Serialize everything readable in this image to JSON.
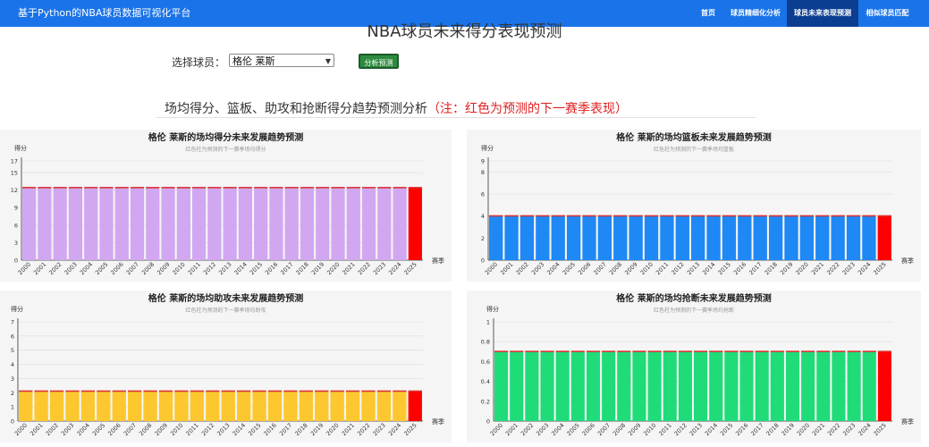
{
  "nav": {
    "brand": "基于Python的NBA球员数据可视化平台",
    "items": [
      {
        "label": "首页",
        "active": false
      },
      {
        "label": "球员精细化分析",
        "active": false
      },
      {
        "label": "球员未来表现预测",
        "active": true
      },
      {
        "label": "相似球员匹配",
        "active": false
      }
    ],
    "color": "#1a73e8",
    "active_color": "#0b3d91"
  },
  "page": {
    "title": "NBA球员未来得分表现预测",
    "select_label": "选择球员：",
    "selected_player": "格伦 莱斯",
    "analyze_button": "分析预测",
    "section_title": "场均得分、篮板、助攻和抢断得分趋势预测分析",
    "section_note": "（注：红色为预测的下一赛季表现）"
  },
  "chart_data": [
    {
      "type": "bar",
      "title": "格伦 莱斯的场均得分未来发展趋势预测",
      "subtitle": "红色柱为预测的下一赛季场均得分",
      "ylabel": "得分",
      "xlabel": "赛季",
      "categories": [
        "2000",
        "2001",
        "2002",
        "2003",
        "2004",
        "2005",
        "2006",
        "2007",
        "2008",
        "2009",
        "2010",
        "2011",
        "2012",
        "2013",
        "2014",
        "2015",
        "2016",
        "2017",
        "2018",
        "2019",
        "2020",
        "2021",
        "2022",
        "2023",
        "2024",
        "2025"
      ],
      "values": [
        12.4,
        12.4,
        12.4,
        12.4,
        12.4,
        12.4,
        12.4,
        12.4,
        12.4,
        12.4,
        12.4,
        12.4,
        12.4,
        12.4,
        12.4,
        12.4,
        12.4,
        12.4,
        12.4,
        12.4,
        12.4,
        12.4,
        12.4,
        12.4,
        12.4,
        12.4
      ],
      "ylim": [
        0,
        17
      ],
      "yticks": [
        0,
        3,
        6,
        9,
        12,
        15,
        17
      ],
      "bar_color": "#d1a7f2",
      "predict_color": "#ff0000"
    },
    {
      "type": "bar",
      "title": "格伦 莱斯的场均篮板未来发展趋势预测",
      "subtitle": "红色柱为预测的下一赛季场均篮板",
      "ylabel": "得分",
      "xlabel": "赛季",
      "categories": [
        "2000",
        "2001",
        "2002",
        "2003",
        "2004",
        "2005",
        "2006",
        "2007",
        "2008",
        "2009",
        "2010",
        "2011",
        "2012",
        "2013",
        "2014",
        "2015",
        "2016",
        "2017",
        "2018",
        "2019",
        "2020",
        "2021",
        "2022",
        "2023",
        "2024",
        "2025"
      ],
      "values": [
        4.0,
        4.0,
        4.0,
        4.0,
        4.0,
        4.0,
        4.0,
        4.0,
        4.0,
        4.0,
        4.0,
        4.0,
        4.0,
        4.0,
        4.0,
        4.0,
        4.0,
        4.0,
        4.0,
        4.0,
        4.0,
        4.0,
        4.0,
        4.0,
        4.0,
        4.0
      ],
      "ylim": [
        0,
        9
      ],
      "yticks": [
        0,
        2,
        4,
        6,
        8,
        9
      ],
      "bar_color": "#1e88f5",
      "predict_color": "#ff0000"
    },
    {
      "type": "bar",
      "title": "格伦 莱斯的场均助攻未来发展趋势预测",
      "subtitle": "红色柱为预测的下一赛季场均助攻",
      "ylabel": "得分",
      "xlabel": "赛季",
      "categories": [
        "2000",
        "2001",
        "2002",
        "2003",
        "2004",
        "2005",
        "2006",
        "2007",
        "2008",
        "2009",
        "2010",
        "2011",
        "2012",
        "2013",
        "2014",
        "2015",
        "2016",
        "2017",
        "2018",
        "2019",
        "2020",
        "2021",
        "2022",
        "2023",
        "2024",
        "2025"
      ],
      "values": [
        2.1,
        2.1,
        2.1,
        2.1,
        2.1,
        2.1,
        2.1,
        2.1,
        2.1,
        2.1,
        2.1,
        2.1,
        2.1,
        2.1,
        2.1,
        2.1,
        2.1,
        2.1,
        2.1,
        2.1,
        2.1,
        2.1,
        2.1,
        2.1,
        2.1,
        2.1
      ],
      "ylim": [
        0,
        7
      ],
      "yticks": [
        0,
        1,
        2,
        3,
        4,
        5,
        6,
        7
      ],
      "bar_color": "#fdc82f",
      "predict_color": "#ff0000"
    },
    {
      "type": "bar",
      "title": "格伦 莱斯的场均抢断未来发展趋势预测",
      "subtitle": "红色柱为预测的下一赛季场均抢断",
      "ylabel": "得分",
      "xlabel": "赛季",
      "categories": [
        "2000",
        "2001",
        "2002",
        "2003",
        "2004",
        "2005",
        "2006",
        "2007",
        "2008",
        "2009",
        "2010",
        "2011",
        "2012",
        "2013",
        "2014",
        "2015",
        "2016",
        "2017",
        "2018",
        "2019",
        "2020",
        "2021",
        "2022",
        "2023",
        "2024",
        "2025"
      ],
      "values": [
        0.7,
        0.7,
        0.7,
        0.7,
        0.7,
        0.7,
        0.7,
        0.7,
        0.7,
        0.7,
        0.7,
        0.7,
        0.7,
        0.7,
        0.7,
        0.7,
        0.7,
        0.7,
        0.7,
        0.7,
        0.7,
        0.7,
        0.7,
        0.7,
        0.7,
        0.7
      ],
      "ylim": [
        0,
        1
      ],
      "yticks": [
        0,
        0.2,
        0.4,
        0.6,
        0.8,
        1
      ],
      "bar_color": "#1fdc78",
      "predict_color": "#ff0000"
    }
  ]
}
